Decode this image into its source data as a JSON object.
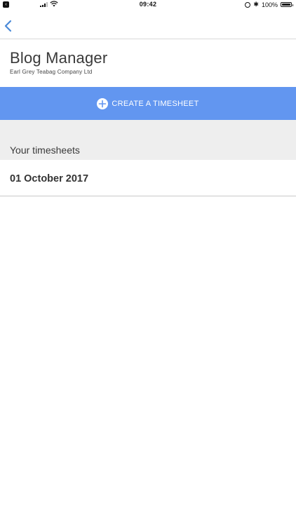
{
  "status_bar": {
    "back_app_glyph": "‹",
    "time": "09:42",
    "battery_percent": "100%",
    "bluetooth_glyph": "✱",
    "icons": [
      "back-to-app-icon",
      "signal-icon",
      "wifi-icon",
      "alarm-icon",
      "bluetooth-icon",
      "battery-icon"
    ]
  },
  "nav": {
    "back_icon": "chevron-left-icon"
  },
  "header": {
    "title": "Blog Manager",
    "subtitle": "Earl Grey Teabag Company Ltd"
  },
  "create_button": {
    "label": "CREATE A TIMESHEET",
    "icon": "plus-circle-icon"
  },
  "section": {
    "title": "Your timesheets"
  },
  "timesheets": [
    {
      "date": "01 October 2017"
    }
  ],
  "colors": {
    "accent": "#6296f0",
    "nav_back": "#4a8ad8",
    "section_bg": "#eeeeee",
    "text": "#333333"
  }
}
